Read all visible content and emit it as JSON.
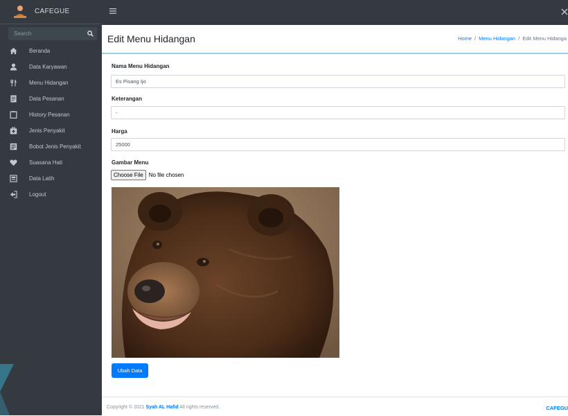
{
  "sidebar": {
    "brand": "CAFEGUE",
    "search_placeholder": "Search",
    "items": [
      {
        "label": "Beranda",
        "icon": "home-icon"
      },
      {
        "label": "Data Karyawan",
        "icon": "user-icon"
      },
      {
        "label": "Menu Hidangan",
        "icon": "utensils-icon"
      },
      {
        "label": "Data Pesanan",
        "icon": "receipt-icon"
      },
      {
        "label": "History Pesanan",
        "icon": "clipboard-icon"
      },
      {
        "label": "Jenis Penyakit",
        "icon": "medkit-icon"
      },
      {
        "label": "Bobot Jenis Penyakit",
        "icon": "calculator-icon"
      },
      {
        "label": "Suasana Hati",
        "icon": "heart-icon"
      },
      {
        "label": "Data Latih",
        "icon": "database-icon"
      },
      {
        "label": "Logout",
        "icon": "logout-icon"
      }
    ]
  },
  "header": {
    "title": "Edit Menu Hidangan",
    "breadcrumb": [
      "Home",
      "Menu Hidangan",
      "Edit Menu Hidanga"
    ]
  },
  "form": {
    "name_label": "Nama Menu Hidangan",
    "name_value": "Es Pisang Ijo",
    "desc_label": "Keterangan",
    "desc_value": "-",
    "price_label": "Harga",
    "price_value": "25000",
    "image_label": "Gambar Menu",
    "file_button": "Choose File",
    "file_status": "No file chosen",
    "submit_label": "Ubah Data"
  },
  "footer": {
    "copyright_prefix": "Copyright © 2021",
    "author": "Syah AL Hafid",
    "suffix": "All rights reserved.",
    "brand": "CAFEGU"
  },
  "colors": {
    "sidebar_bg": "#343a40",
    "accent": "#007bff",
    "header_line": "#9bd0e8"
  }
}
